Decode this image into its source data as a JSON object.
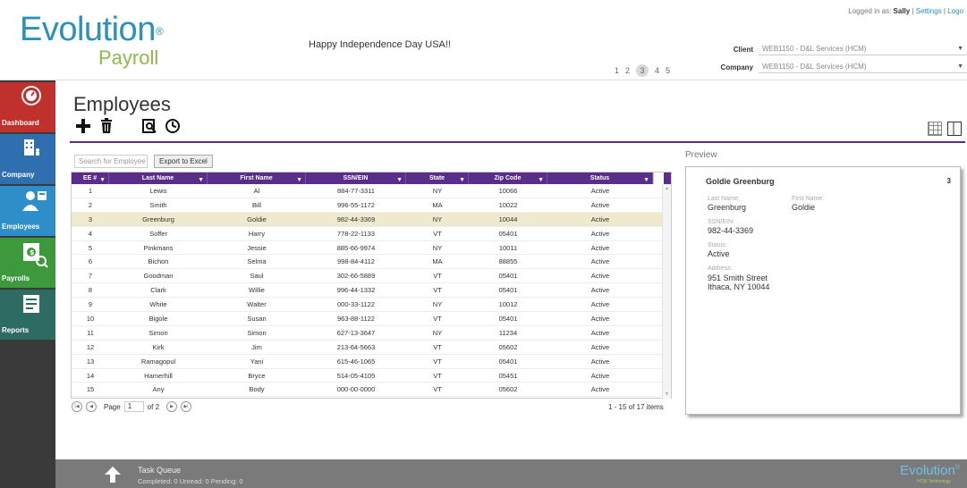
{
  "brand": {
    "name": "Evolution",
    "sub": "Payroll",
    "reg": "®"
  },
  "announcement": "Happy Independence Day USA!!",
  "top_pager": [
    "1",
    "2",
    "3",
    "4",
    "5"
  ],
  "top_pager_current": "3",
  "user": {
    "prefix": "Logged in as: ",
    "name": "Sally",
    "settings": "Settings",
    "sep": " | ",
    "logout": "Logo"
  },
  "client": {
    "label": "Client",
    "value": "WEB1150 - D&L Services (HCM)"
  },
  "company": {
    "label": "Company",
    "value": "WEB1150 - D&L Services (HCM)"
  },
  "nav": [
    {
      "label": "Dashboard",
      "icon": "dashboard-icon"
    },
    {
      "label": "Company",
      "icon": "building-icon"
    },
    {
      "label": "Employees",
      "icon": "employee-icon"
    },
    {
      "label": "Payrolls",
      "icon": "payroll-icon"
    },
    {
      "label": "Reports",
      "icon": "report-icon"
    }
  ],
  "page_title": "Employees",
  "search_placeholder": "Search for Employee",
  "export_label": "Export to Excel",
  "columns": [
    "EE #",
    "Last Name",
    "First Name",
    "SSN/EIN",
    "State",
    "Zip Code",
    "Status"
  ],
  "rows": [
    [
      "1",
      "Lewis",
      "Al",
      "884-77-3311",
      "NY",
      "10066",
      "Active"
    ],
    [
      "2",
      "Smith",
      "Bill",
      "996-55-1172",
      "MA",
      "10022",
      "Active"
    ],
    [
      "3",
      "Greenburg",
      "Goldie",
      "982-44-3369",
      "NY",
      "10044",
      "Active"
    ],
    [
      "4",
      "Soffer",
      "Harry",
      "778-22-1133",
      "VT",
      "05401",
      "Active"
    ],
    [
      "5",
      "Pinkmans",
      "Jessie",
      "885-66-9974",
      "NY",
      "10011",
      "Active"
    ],
    [
      "6",
      "Bichon",
      "Selma",
      "998-84-4112",
      "MA",
      "88855",
      "Active"
    ],
    [
      "7",
      "Goodman",
      "Saul",
      "302-66-5889",
      "VT",
      "05401",
      "Active"
    ],
    [
      "8",
      "Clark",
      "Willie",
      "996-44-1332",
      "VT",
      "05401",
      "Active"
    ],
    [
      "9",
      "White",
      "Walter",
      "000-33-1122",
      "NY",
      "10012",
      "Active"
    ],
    [
      "10",
      "Bigole",
      "Susan",
      "963-88-1122",
      "VT",
      "05401",
      "Active"
    ],
    [
      "11",
      "Simon",
      "Simon",
      "627-13-3647",
      "NY",
      "11234",
      "Active"
    ],
    [
      "12",
      "Kirk",
      "Jim",
      "213-64-5663",
      "VT",
      "05602",
      "Active"
    ],
    [
      "13",
      "Ramagopul",
      "Yani",
      "615-46-1065",
      "VT",
      "05401",
      "Active"
    ],
    [
      "14",
      "Hamerhill",
      "Bryce",
      "514-05-4105",
      "VT",
      "05451",
      "Active"
    ],
    [
      "15",
      "Any",
      "Body",
      "000-00-0000",
      "VT",
      "05602",
      "Active"
    ]
  ],
  "selected_row": 3,
  "pager": {
    "page_label": "Page",
    "page": "1",
    "of": "of 2",
    "items": "1 - 15 of 17 items"
  },
  "preview": {
    "title": "Preview",
    "name": "Goldie Greenburg",
    "number": "3",
    "last_name_label": "Last Name:",
    "last_name": "Greenburg",
    "first_name_label": "First Name:",
    "first_name": "Goldie",
    "ssn_label": "SSN/EIN:",
    "ssn": "982-44-3369",
    "status_label": "Status:",
    "status": "Active",
    "address_label": "Address:",
    "address1": "951 Smith Street",
    "address2": "Ithaca, NY 10044"
  },
  "footer": {
    "task_queue": "Task Queue",
    "counts": "Completed: 0   Unread: 0   Pending: 0",
    "logo": "Evolution",
    "logo_sub": "HCM Technology"
  },
  "colors": {
    "purple": "#5a2d8b",
    "blue": "#2b8fbf",
    "green": "#8bb94a",
    "selected_row": "#efeacd"
  }
}
